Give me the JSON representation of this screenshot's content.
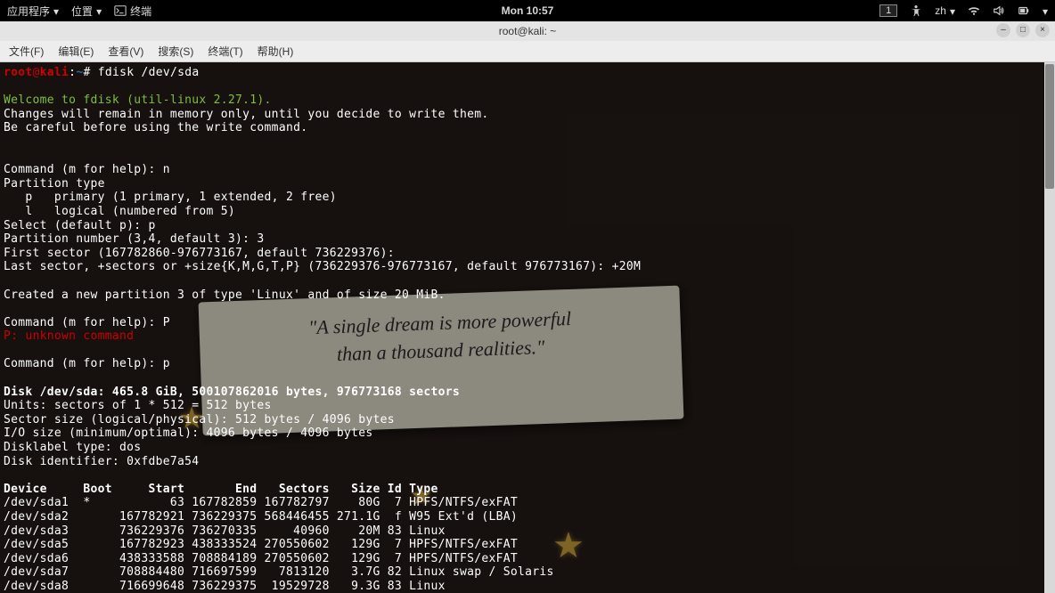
{
  "toppanel": {
    "apps": "应用程序",
    "places": "位置",
    "terminal": "终端",
    "clock": "Mon 10:57",
    "lang": "zh",
    "indicator": "1"
  },
  "window": {
    "title": "root@kali: ~"
  },
  "menubar": {
    "file": "文件(F)",
    "edit": "编辑(E)",
    "view": "查看(V)",
    "search": "搜索(S)",
    "terminal": "终端(T)",
    "help": "帮助(H)"
  },
  "prompt": {
    "user": "root",
    "at": "@",
    "host": "kali",
    "colon": ":",
    "path": "~",
    "hash": "# ",
    "cmd": "fdisk /dev/sda"
  },
  "welcome": "Welcome to fdisk (util-linux 2.27.1).",
  "lines": {
    "l1": "Changes will remain in memory only, until you decide to write them.",
    "l2": "Be careful before using the write command.",
    "cmd_n": "Command (m for help): n",
    "ptype": "Partition type",
    "pprim": "   p   primary (1 primary, 1 extended, 2 free)",
    "plog": "   l   logical (numbered from 5)",
    "sel_p": "Select (default p): p",
    "pnum": "Partition number (3,4, default 3): 3",
    "fsec": "First sector (167782860-976773167, default 736229376):",
    "lsec": "Last sector, +sectors or +size{K,M,G,T,P} (736229376-976773167, default 976773167): +20M",
    "created": "Created a new partition 3 of type 'Linux' and of size 20 MiB.",
    "cmd_P": "Command (m for help): P",
    "unknown": "P: unknown command",
    "cmd_p": "Command (m for help): p",
    "disk_hdr": "Disk /dev/sda: 465.8 GiB, 500107862016 bytes, 976773168 sectors",
    "units": "Units: sectors of 1 * 512 = 512 bytes",
    "secsz": "Sector size (logical/physical): 512 bytes / 4096 bytes",
    "iosz": "I/O size (minimum/optimal): 4096 bytes / 4096 bytes",
    "dltype": "Disklabel type: dos",
    "diskid": "Disk identifier: 0xfdbe7a54",
    "tbl_hdr": "Device     Boot     Start       End   Sectors   Size Id Type",
    "r1": "/dev/sda1  *           63 167782859 167782797    80G  7 HPFS/NTFS/exFAT",
    "r2": "/dev/sda2       167782921 736229375 568446455 271.1G  f W95 Ext'd (LBA)",
    "r3": "/dev/sda3       736229376 736270335     40960    20M 83 Linux",
    "r4": "/dev/sda5       167782923 438333524 270550602   129G  7 HPFS/NTFS/exFAT",
    "r5": "/dev/sda6       438333588 708884189 270550602   129G  7 HPFS/NTFS/exFAT",
    "r6": "/dev/sda7       708884480 716697599   7813120   3.7G 82 Linux swap / Solaris",
    "r7": "/dev/sda8       716699648 736229375  19529728   9.3G 83 Linux"
  },
  "paper": {
    "line1": "\"A single dream is more powerful",
    "line2": "than a thousand realities.\""
  }
}
